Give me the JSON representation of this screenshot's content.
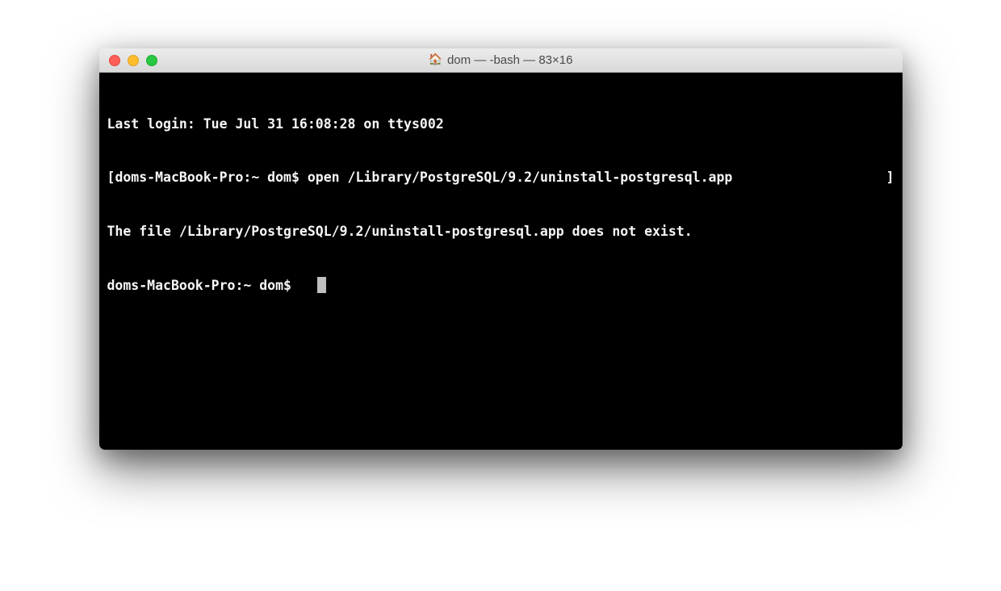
{
  "window": {
    "title": "dom — -bash — 83×16",
    "home_icon": "🏠"
  },
  "terminal": {
    "last_login": "Last login: Tue Jul 31 16:08:28 on ttys002",
    "prompt_open": "[",
    "prompt_close": "]",
    "line1_prompt": "doms-MacBook-Pro:~ dom$ ",
    "line1_command": "open /Library/PostgreSQL/9.2/uninstall-postgresql.app",
    "line2": "The file /Library/PostgreSQL/9.2/uninstall-postgresql.app does not exist.",
    "line3_prompt": "doms-MacBook-Pro:~ dom$ ",
    "line3_input": "  "
  }
}
